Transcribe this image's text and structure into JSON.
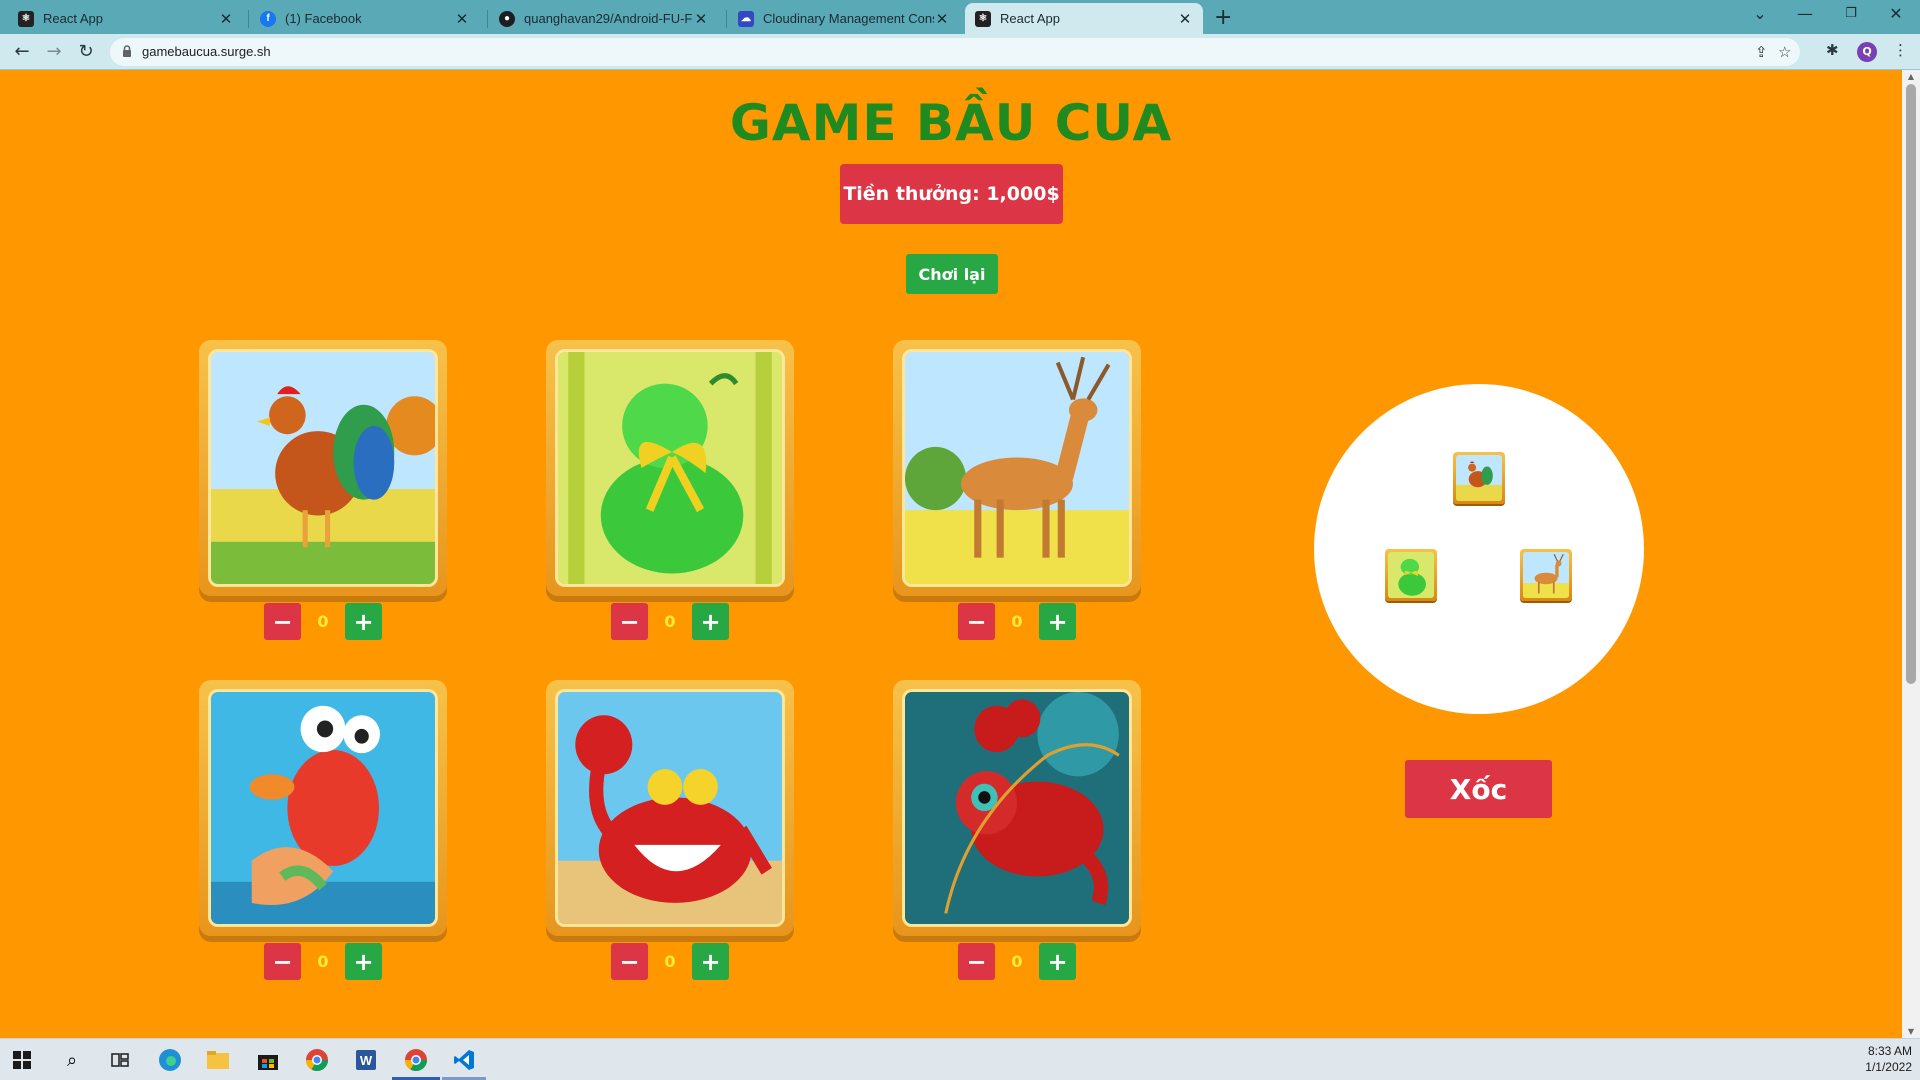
{
  "browser": {
    "tabs": [
      {
        "title": "React App",
        "icon": "react-icon"
      },
      {
        "title": "(1) Facebook",
        "icon": "facebook-icon"
      },
      {
        "title": "quanghavan29/Android-FU-Food",
        "icon": "github-icon"
      },
      {
        "title": "Cloudinary Management Console",
        "icon": "cloudinary-icon"
      },
      {
        "title": "React App",
        "icon": "react-icon"
      }
    ],
    "url": "gamebaucua.surge.sh",
    "profile_initial": "Q"
  },
  "game": {
    "title": "GAME BẦU CUA",
    "prize_label": "Tiền thưởng: 1,000$",
    "replay_label": "Chơi lại",
    "shake_label": "Xốc",
    "bets": [
      {
        "animal": "rooster",
        "value": "0"
      },
      {
        "animal": "gourd",
        "value": "0"
      },
      {
        "animal": "deer",
        "value": "0"
      },
      {
        "animal": "fish",
        "value": "0"
      },
      {
        "animal": "crab",
        "value": "0"
      },
      {
        "animal": "shrimp",
        "value": "0"
      }
    ],
    "dice": [
      "rooster",
      "gourd",
      "deer"
    ],
    "minus_symbol": "−",
    "plus_symbol": "+"
  },
  "taskbar": {
    "time": "8:33 AM",
    "date": "1/1/2022"
  },
  "colors": {
    "background": "#ff9800",
    "title": "#1f8a1f",
    "danger": "#dc3545",
    "success": "#28a745",
    "bet_value": "#ffeb3b"
  }
}
